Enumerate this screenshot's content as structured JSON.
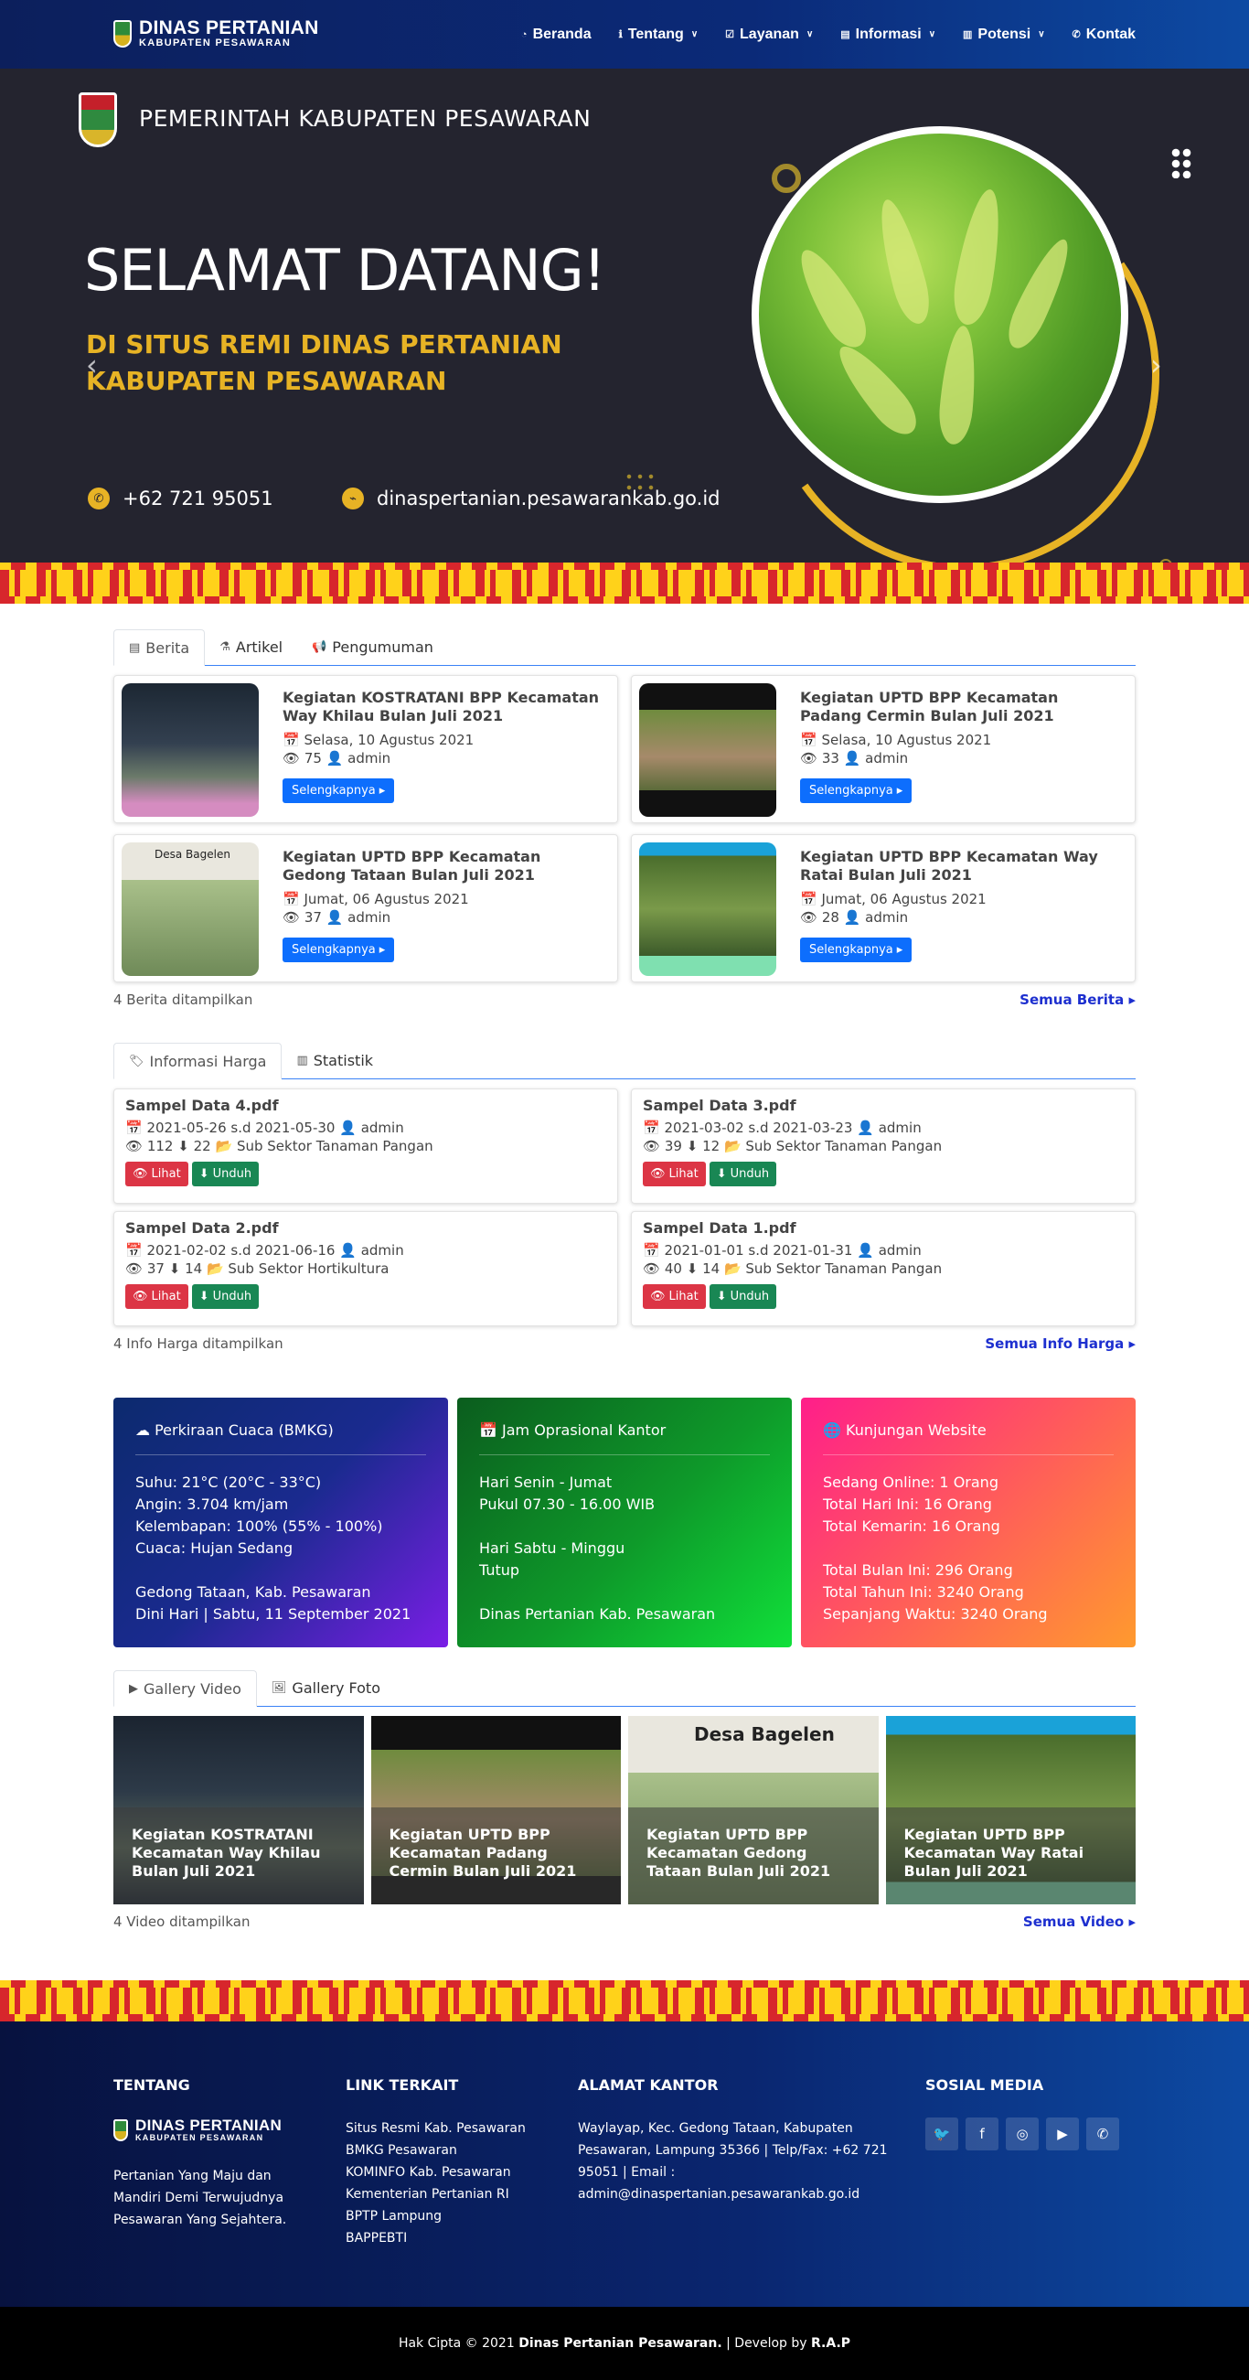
{
  "navbar": {
    "brand_line1": "DINAS PERTANIAN",
    "brand_line2": "KABUPATEN PESAWARAN",
    "items": [
      {
        "label": "Beranda",
        "icon": "dashboard-icon"
      },
      {
        "label": "Tentang",
        "icon": "info-icon"
      },
      {
        "label": "Layanan",
        "icon": "checklist-icon"
      },
      {
        "label": "Informasi",
        "icon": "newspaper-icon"
      },
      {
        "label": "Potensi",
        "icon": "bar-chart-icon"
      },
      {
        "label": "Kontak",
        "icon": "phone-icon"
      }
    ]
  },
  "hero": {
    "gov_title": "PEMERINTAH KABUPATEN PESAWARAN",
    "welcome": "SELAMAT DATANG!",
    "sub_line1": "DI SITUS REMI DINAS PERTANIAN",
    "sub_line2": "KABUPATEN PESAWARAN",
    "phone": "+62 721 95051",
    "website": "dinaspertanian.pesawarankab.go.id"
  },
  "news_tabs": [
    "Berita",
    "Artikel",
    "Pengumuman"
  ],
  "news": [
    {
      "title": "Kegiatan KOSTRATANI BPP Kecamatan Way Khilau Bulan Juli 2021",
      "date": "Selasa, 10 Agustus 2021",
      "views": "75",
      "author": "admin",
      "button": "Selengkapnya"
    },
    {
      "title": "Kegiatan UPTD BPP Kecamatan Padang Cermin Bulan Juli 2021",
      "date": "Selasa, 10 Agustus 2021",
      "views": "33",
      "author": "admin",
      "button": "Selengkapnya"
    },
    {
      "title": "Kegiatan UPTD BPP Kecamatan Gedong Tataan Bulan Juli 2021",
      "date": "Jumat, 06 Agustus 2021",
      "views": "37",
      "author": "admin",
      "button": "Selengkapnya"
    },
    {
      "title": "Kegiatan UPTD BPP Kecamatan Way Ratai Bulan Juli 2021",
      "date": "Jumat, 06 Agustus 2021",
      "views": "28",
      "author": "admin",
      "button": "Selengkapnya"
    }
  ],
  "news_thumb_label": "Desa Bagelen",
  "news_footer": {
    "count": "4 Berita ditampilkan",
    "more": "Semua Berita"
  },
  "price_tabs": [
    "Informasi Harga",
    "Statistik"
  ],
  "prices": [
    {
      "title": "Sampel Data 4.pdf",
      "range": "2021-05-26 s.d 2021-05-30",
      "author": "admin",
      "views": "112",
      "downloads": "22",
      "sector": "Sub Sektor Tanaman Pangan"
    },
    {
      "title": "Sampel Data 3.pdf",
      "range": "2021-03-02 s.d 2021-03-23",
      "author": "admin",
      "views": "39",
      "downloads": "12",
      "sector": "Sub Sektor Tanaman Pangan"
    },
    {
      "title": "Sampel Data 2.pdf",
      "range": "2021-02-02 s.d 2021-06-16",
      "author": "admin",
      "views": "37",
      "downloads": "14",
      "sector": "Sub Sektor Hortikultura"
    },
    {
      "title": "Sampel Data 1.pdf",
      "range": "2021-01-01 s.d 2021-01-31",
      "author": "admin",
      "views": "40",
      "downloads": "14",
      "sector": "Sub Sektor Tanaman Pangan"
    }
  ],
  "price_buttons": {
    "view": "Lihat",
    "download": "Unduh"
  },
  "price_footer": {
    "count": "4 Info Harga ditampilkan",
    "more": "Semua Info Harga"
  },
  "cards": [
    {
      "title": "Perkiraan Cuaca (BMKG)",
      "lines": [
        "Suhu: 21°C (20°C - 33°C)",
        "Angin: 3.704 km/jam",
        "Kelembapan: 100% (55% - 100%)",
        "Cuaca: Hujan Sedang",
        "",
        "Gedong Tataan, Kab. Pesawaran",
        "Dini Hari | Sabtu, 11 September 2021"
      ]
    },
    {
      "title": "Jam Oprasional Kantor",
      "lines": [
        "Hari Senin - Jumat",
        "Pukul 07.30 - 16.00 WIB",
        "",
        "Hari Sabtu - Minggu",
        "Tutup",
        "",
        "Dinas Pertanian Kab. Pesawaran"
      ]
    },
    {
      "title": "Kunjungan Website",
      "lines": [
        "Sedang Online: 1 Orang",
        "Total Hari Ini: 16 Orang",
        "Total Kemarin: 16 Orang",
        "",
        "Total Bulan Ini: 296 Orang",
        "Total Tahun Ini: 3240 Orang",
        "Sepanjang Waktu: 3240 Orang"
      ]
    }
  ],
  "gallery_tabs": [
    "Gallery Video",
    "Gallery Foto"
  ],
  "videos": [
    "Kegiatan KOSTRATANI Kecamatan Way Khilau Bulan Juli 2021",
    "Kegiatan UPTD BPP Kecamatan Padang Cermin Bulan Juli 2021",
    "Kegiatan UPTD BPP Kecamatan Gedong Tataan Bulan Juli 2021",
    "Kegiatan UPTD BPP Kecamatan Way Ratai Bulan Juli 2021"
  ],
  "gallery_footer": {
    "count": "4 Video ditampilkan",
    "more": "Semua Video"
  },
  "footer": {
    "about_title": "TENTANG",
    "about_brand1": "DINAS PERTANIAN",
    "about_brand2": "KABUPATEN PESAWARAN",
    "about_text": "Pertanian Yang Maju dan Mandiri Demi Terwujudnya Pesawaran Yang Sejahtera.",
    "links_title": "LINK TERKAIT",
    "links": [
      "Situs Resmi Kab. Pesawaran",
      "BMKG Pesawaran",
      "KOMINFO Kab. Pesawaran",
      "Kementerian Pertanian RI",
      "BPTP Lampung",
      "BAPPEBTI"
    ],
    "address_title": "ALAMAT KANTOR",
    "address": "Waylayap, Kec. Gedong Tataan, Kabupaten Pesawaran, Lampung 35366 | Telp/Fax: +62 721 95051 | Email : admin@dinaspertanian.pesawarankab.go.id",
    "social_title": "SOSIAL MEDIA",
    "social": [
      "twitter-icon",
      "facebook-icon",
      "instagram-icon",
      "youtube-icon",
      "whatsapp-icon"
    ]
  },
  "copyright": {
    "prefix": "Hak Cipta © 2021",
    "owner": "Dinas Pertanian Pesawaran.",
    "mid": "| Develop by",
    "dev": "R.A.P"
  },
  "colors": {
    "nav_start": "#0c1f5c",
    "primary_blue": "#0d6efd",
    "danger": "#dc3545",
    "success": "#198754",
    "gold": "#e7b325"
  }
}
